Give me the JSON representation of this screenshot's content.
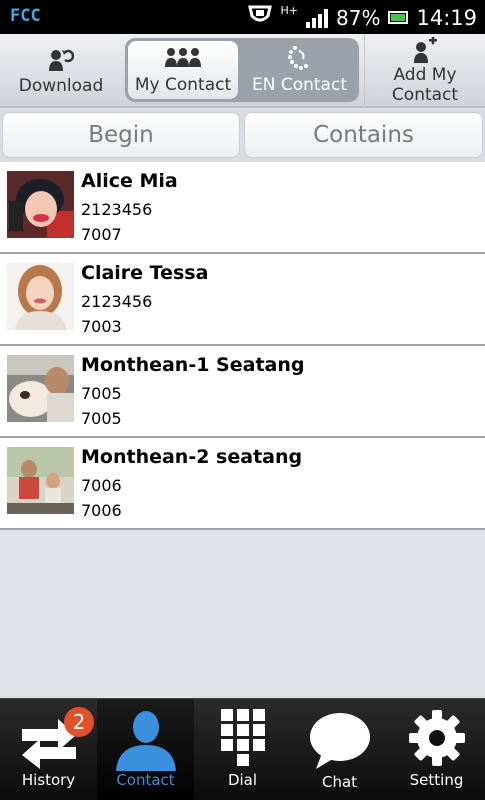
{
  "status_bar": {
    "carrier_text": "FCC",
    "battery_percent": "87%",
    "time": "14:19",
    "network_type": "H+",
    "battery_level": 0.87,
    "icons": [
      "bug-icon",
      "signal-icon",
      "battery-icon"
    ]
  },
  "toolbar": {
    "download_label": "Download",
    "my_contact_label": "My Contact",
    "en_contact_label": "EN Contact",
    "add_my_contact_label_line1": "Add My",
    "add_my_contact_label_line2": "Contact",
    "selected_segment": "My Contact"
  },
  "search_modes": {
    "begin_label": "Begin",
    "contains_label": "Contains"
  },
  "contacts": [
    {
      "name": "Alice Mia",
      "line1": "2123456",
      "line2": "7007"
    },
    {
      "name": "Claire Tessa",
      "line1": "2123456",
      "line2": "7003"
    },
    {
      "name": "Monthean-1 Seatang",
      "line1": "7005",
      "line2": "7005"
    },
    {
      "name": "Monthean-2 seatang",
      "line1": "7006",
      "line2": "7006"
    }
  ],
  "tabs": [
    {
      "label": "History",
      "icon": "history-arrows-icon",
      "badge": "2"
    },
    {
      "label": "Contact",
      "icon": "person-icon",
      "active": true
    },
    {
      "label": "Dial",
      "icon": "keypad-icon"
    },
    {
      "label": "Chat",
      "icon": "speech-bubble-icon"
    },
    {
      "label": "Setting",
      "icon": "gear-icon"
    }
  ],
  "colors": {
    "active_tab": "#3c8fdc",
    "badge": "#e0502a",
    "battery": "#47c447"
  }
}
